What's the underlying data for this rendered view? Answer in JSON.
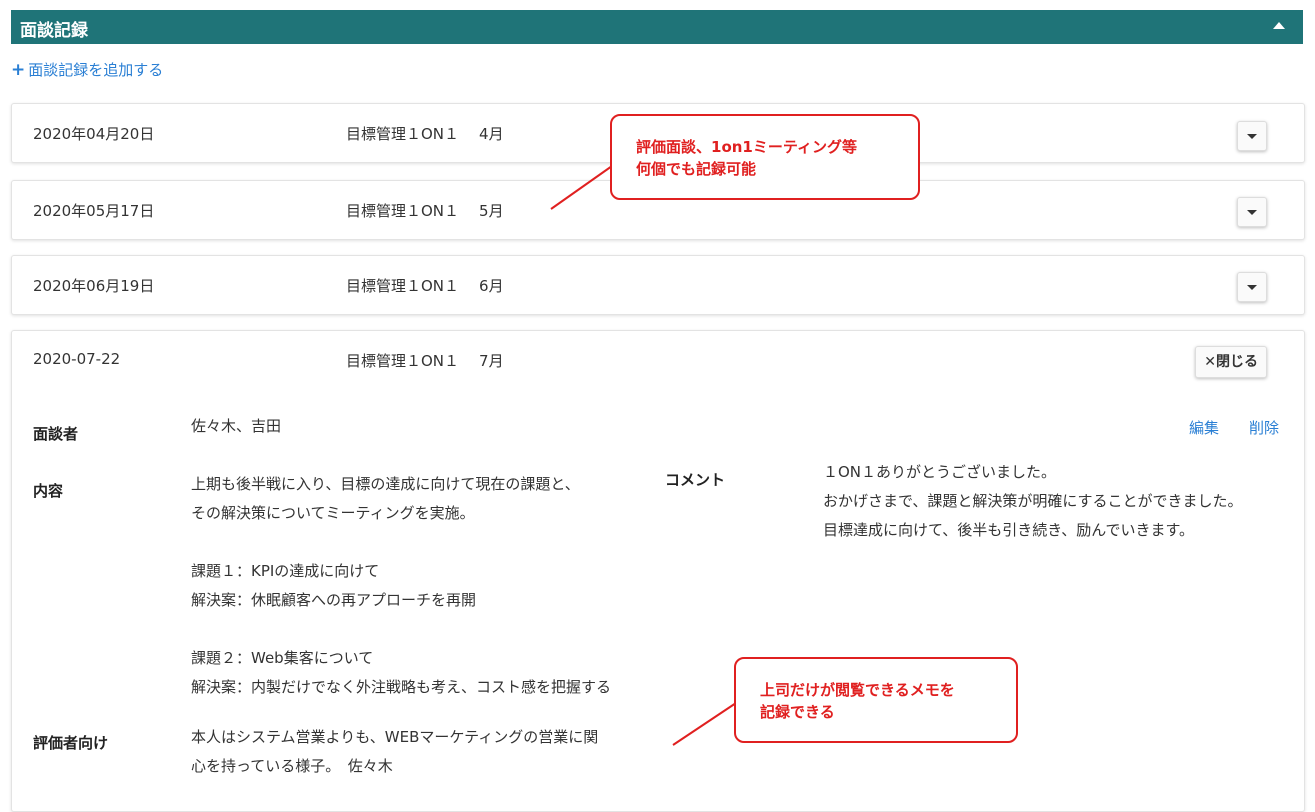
{
  "header": {
    "title": "面談記録"
  },
  "add_link": {
    "label": "面談記録を追加する"
  },
  "records": [
    {
      "date": "2020年04月20日",
      "name": "目標管理１ON１",
      "month": "4月"
    },
    {
      "date": "2020年05月17日",
      "name": "目標管理１ON１",
      "month": "5月"
    },
    {
      "date": "2020年06月19日",
      "name": "目標管理１ON１",
      "month": "6月"
    }
  ],
  "expanded": {
    "date": "2020-07-22",
    "name": "目標管理１ON１",
    "month": "7月",
    "close_label": "✕閉じる",
    "edit_label": "編集",
    "delete_label": "削除",
    "interviewer_label": "面談者",
    "interviewer_value": "佐々木、吉田",
    "content_label": "内容",
    "content_value": "上期も後半戦に入り、目標の達成に向けて現在の課題と、\nその解決策についてミーティングを実施。\n\n課題１：KPIの達成に向けて\n解決案：休眠顧客への再アプローチを再開\n\n課題２：Web集客について\n解決案：内製だけでなく外注戦略も考え、コスト感を把握する",
    "comment_label": "コメント",
    "comment_value": "１ON１ありがとうございました。\nおかげさまで、課題と解決策が明確にすることができました。\n目標達成に向けて、後半も引き続き、励んでいきます。",
    "evaluator_label": "評価者向け",
    "evaluator_value": "本人はシステム営業よりも、WEBマーケティングの営業に関\n心を持っている様子。　佐々木"
  },
  "callouts": {
    "top": "評価面談、1on1ミーティング等\n何個でも記録可能",
    "bottom": "上司だけが閲覧できるメモを\n記録できる"
  },
  "colors": {
    "header": "#1f7478",
    "link": "#2a7fd4",
    "callout": "#e02020"
  }
}
